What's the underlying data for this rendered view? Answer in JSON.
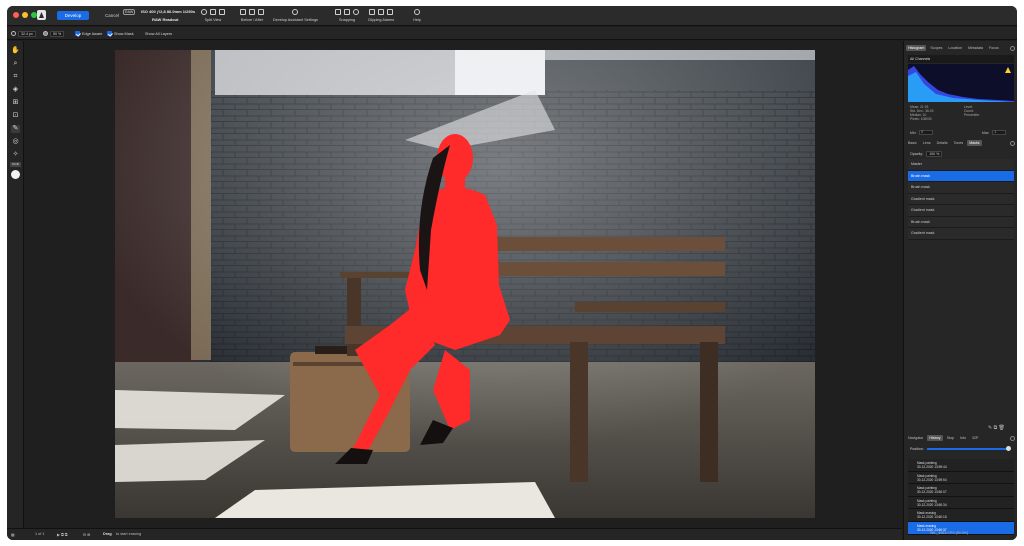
{
  "window": {
    "traffic_lights": [
      "#ff5f57",
      "#febc2e",
      "#28c840"
    ],
    "accent": "#1a6ce6"
  },
  "toolbar": {
    "develop_label": "Develop",
    "cancel_label": "Cancel",
    "raw_badge": "RAW",
    "exif": "ISO 400 ƒ/2,8 86.0mm 1/250s",
    "raw_label": "RAW Readout",
    "groups": [
      {
        "label": "Split View"
      },
      {
        "label": "Before / After"
      },
      {
        "label": "Develop Assistant Settings"
      },
      {
        "label": "Snapping"
      },
      {
        "label": "Clipping Alarms"
      },
      {
        "label": "Help"
      }
    ]
  },
  "context_bar": {
    "size_value": "32.4 px",
    "opacity_value": "50 %",
    "edge_aware": "Edge Aware",
    "show_mask": "Show Mask",
    "show_all_layers": "Show All Layers"
  },
  "tools": {
    "badge": "RGB"
  },
  "status": {
    "page_indicator": "1 of 1",
    "hint_bold": "Drag",
    "hint": "to start erasing"
  },
  "right_panel": {
    "top_tabs": [
      "Histogram",
      "Scopes",
      "Location",
      "Metadata",
      "Focus"
    ],
    "channels": "All Channels",
    "stats_left": [
      "Mean: 21.93",
      "Std. Dev.: 36.03",
      "Median: 10",
      "Pixels: 108000"
    ],
    "stats_right": [
      "Level:",
      "Count:",
      "Percentile:"
    ],
    "min_label": "Min:",
    "min_value": "0",
    "max_label": "Max:",
    "max_value": "1",
    "mid_tabs": [
      "Basic",
      "Lens",
      "Details",
      "Tones",
      "Masks"
    ],
    "opacity_label": "Opacity:",
    "opacity_value": "100 %",
    "masks": [
      "Master",
      "Brush mask",
      "Brush mask",
      "Gradient mask",
      "Gradient mask",
      "Brush mask",
      "Gradient mask"
    ],
    "bottom_tabs": [
      "Navigator",
      "History",
      "Stop",
      "Info",
      "32P"
    ],
    "position_label": "Position:",
    "history": [
      {
        "title": "Mask painting",
        "date": "30-12-2020 13:59:44"
      },
      {
        "title": "Mask painting",
        "date": "30-12-2020 13:59:54"
      },
      {
        "title": "Mask painting",
        "date": "30-12-2020 13:60:07"
      },
      {
        "title": "Mask painting",
        "date": "30-12-2020 13:60:34"
      },
      {
        "title": "Mask erasing",
        "date": "30-12-2020 13:60:18"
      },
      {
        "title": "Mask erasing",
        "date": "30-12-2020 13:60:37"
      }
    ],
    "filename": "WIL_4063.CR3 (50.0%)"
  }
}
